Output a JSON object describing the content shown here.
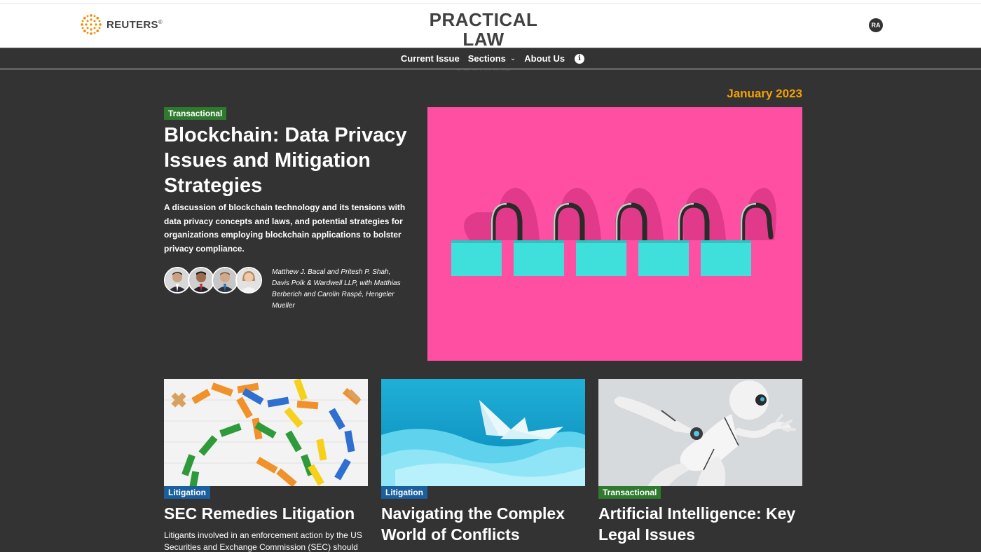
{
  "header": {
    "brand": "REUTERS",
    "brand_mark": "®",
    "logo_title": "PRACTICAL LAW",
    "logo_subtitle": "THE JOURNAL",
    "user_initials": "RA"
  },
  "nav": {
    "items": [
      {
        "label": "Current Issue"
      },
      {
        "label": "Sections"
      },
      {
        "label": "About Us"
      }
    ],
    "info_icon": "info-icon"
  },
  "issue_date": "January 2023",
  "feature": {
    "category": "Transactional",
    "title": "Blockchain: Data Privacy Issues and Mitigation Strategies",
    "description": "A discussion of blockchain technology and its tensions with data privacy concepts and laws, and potential strategies for organizations employing blockchain applications to bolster privacy compliance.",
    "authors": "Matthew J. Bacal and Pritesh P. Shah, Davis Polk & Wardwell LLP, with Matthias Berberich and Carolin Raspé, Hengeler Mueller"
  },
  "cards": [
    {
      "category": "Litigation",
      "title": "SEC Remedies Litigation",
      "description": "Litigants involved in an enforcement action by the US Securities and Exchange Commission (SEC) should"
    },
    {
      "category": "Litigation",
      "title": "Navigating the Complex World of Conflicts",
      "description": ""
    },
    {
      "category": "Transactional",
      "title": "Artificial Intelligence: Key Legal Issues",
      "description": ""
    }
  ],
  "colors": {
    "accent_orange": "#f5a000",
    "transactional": "#2f7a2f",
    "litigation": "#1a5f9e",
    "background": "#333333",
    "feature_image_bg": "#ff4fa3",
    "padlock": "#3fe0dc"
  }
}
